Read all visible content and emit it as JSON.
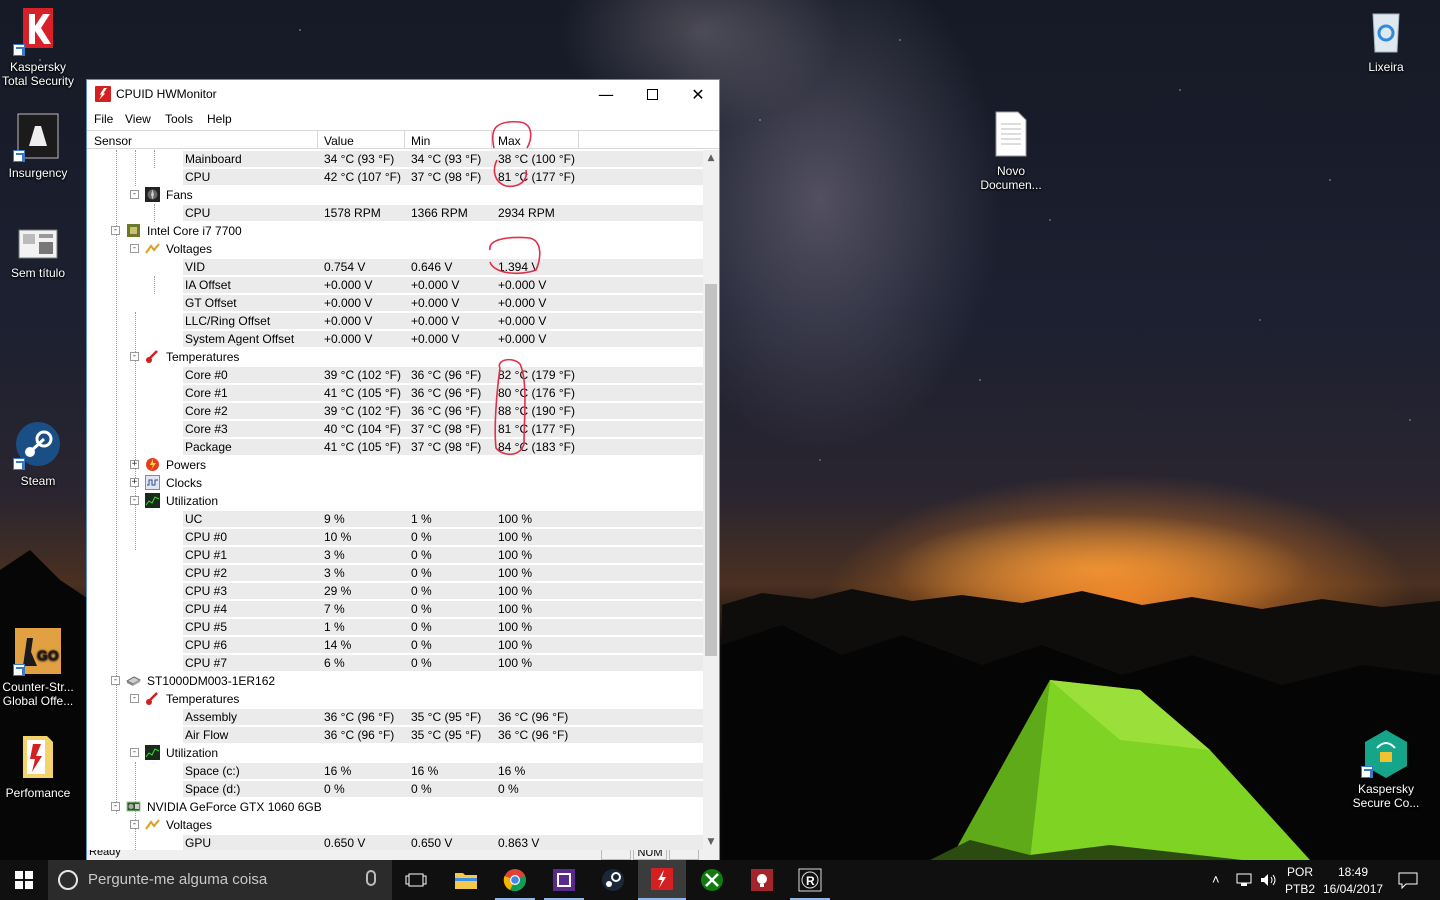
{
  "desktop": {
    "icons_left": [
      {
        "label": "Kaspersky Total Security"
      },
      {
        "label": "Insurgency"
      },
      {
        "label": "Sem título"
      },
      {
        "label": "Steam"
      },
      {
        "label": "Counter-Str... Global Offe..."
      },
      {
        "label": "Perfomance"
      }
    ],
    "icons_right": [
      {
        "label": "Lixeira"
      },
      {
        "label": "Novo Documen..."
      },
      {
        "label": "Kaspersky Secure Co..."
      }
    ]
  },
  "window": {
    "title": "CPUID HWMonitor",
    "menu": [
      "File",
      "View",
      "Tools",
      "Help"
    ],
    "columns": [
      "Sensor",
      "Value",
      "Min",
      "Max"
    ],
    "rows": [
      {
        "label": "Mainboard",
        "value": "34 °C  (93 °F)",
        "min": "34 °C  (93 °F)",
        "max": "38 °C  (100 °F)"
      },
      {
        "label": "CPU",
        "value": "42 °C  (107 °F)",
        "min": "37 °C  (98 °F)",
        "max": "81 °C  (177 °F)"
      },
      {
        "label": "Fans"
      },
      {
        "label": "CPU",
        "value": "1578 RPM",
        "min": "1366 RPM",
        "max": "2934 RPM"
      },
      {
        "label": "Intel Core i7 7700"
      },
      {
        "label": "Voltages"
      },
      {
        "label": "VID",
        "value": "0.754 V",
        "min": "0.646 V",
        "max": "1.394 V"
      },
      {
        "label": "IA Offset",
        "value": "+0.000 V",
        "min": "+0.000 V",
        "max": "+0.000 V"
      },
      {
        "label": "GT Offset",
        "value": "+0.000 V",
        "min": "+0.000 V",
        "max": "+0.000 V"
      },
      {
        "label": "LLC/Ring Offset",
        "value": "+0.000 V",
        "min": "+0.000 V",
        "max": "+0.000 V"
      },
      {
        "label": "System Agent Offset",
        "value": "+0.000 V",
        "min": "+0.000 V",
        "max": "+0.000 V"
      },
      {
        "label": "Temperatures"
      },
      {
        "label": "Core #0",
        "value": "39 °C  (102 °F)",
        "min": "36 °C  (96 °F)",
        "max": "82 °C  (179 °F)"
      },
      {
        "label": "Core #1",
        "value": "41 °C  (105 °F)",
        "min": "36 °C  (96 °F)",
        "max": "80 °C  (176 °F)"
      },
      {
        "label": "Core #2",
        "value": "39 °C  (102 °F)",
        "min": "36 °C  (96 °F)",
        "max": "88 °C  (190 °F)"
      },
      {
        "label": "Core #3",
        "value": "40 °C  (104 °F)",
        "min": "37 °C  (98 °F)",
        "max": "81 °C  (177 °F)"
      },
      {
        "label": "Package",
        "value": "41 °C  (105 °F)",
        "min": "37 °C  (98 °F)",
        "max": "84 °C  (183 °F)"
      },
      {
        "label": "Powers"
      },
      {
        "label": "Clocks"
      },
      {
        "label": "Utilization"
      },
      {
        "label": "UC",
        "value": "9 %",
        "min": "1 %",
        "max": "100 %"
      },
      {
        "label": "CPU #0",
        "value": "10 %",
        "min": "0 %",
        "max": "100 %"
      },
      {
        "label": "CPU #1",
        "value": "3 %",
        "min": "0 %",
        "max": "100 %"
      },
      {
        "label": "CPU #2",
        "value": "3 %",
        "min": "0 %",
        "max": "100 %"
      },
      {
        "label": "CPU #3",
        "value": "29 %",
        "min": "0 %",
        "max": "100 %"
      },
      {
        "label": "CPU #4",
        "value": "7 %",
        "min": "0 %",
        "max": "100 %"
      },
      {
        "label": "CPU #5",
        "value": "1 %",
        "min": "0 %",
        "max": "100 %"
      },
      {
        "label": "CPU #6",
        "value": "14 %",
        "min": "0 %",
        "max": "100 %"
      },
      {
        "label": "CPU #7",
        "value": "6 %",
        "min": "0 %",
        "max": "100 %"
      },
      {
        "label": "ST1000DM003-1ER162"
      },
      {
        "label": "Temperatures"
      },
      {
        "label": "Assembly",
        "value": "36 °C  (96 °F)",
        "min": "35 °C  (95 °F)",
        "max": "36 °C  (96 °F)"
      },
      {
        "label": "Air Flow",
        "value": "36 °C  (96 °F)",
        "min": "35 °C  (95 °F)",
        "max": "36 °C  (96 °F)"
      },
      {
        "label": "Utilization"
      },
      {
        "label": "Space (c:)",
        "value": "16 %",
        "min": "16 %",
        "max": "16 %"
      },
      {
        "label": "Space (d:)",
        "value": "0 %",
        "min": "0 %",
        "max": "0 %"
      },
      {
        "label": "NVIDIA GeForce GTX 1060 6GB"
      },
      {
        "label": "Voltages"
      },
      {
        "label": "GPU",
        "value": "0.650 V",
        "min": "0.650 V",
        "max": "0.863 V"
      }
    ],
    "status": {
      "left": "Ready",
      "num": "NUM"
    }
  },
  "taskbar": {
    "search_placeholder": "Pergunte-me alguma coisa",
    "apps": [
      "task-view",
      "file-explorer",
      "chrome",
      "cpu-app",
      "steam",
      "hwmonitor",
      "xbox",
      "app-bulb",
      "app-r"
    ],
    "lang_top": "POR",
    "lang_bottom": "PTB2",
    "time": "18:49",
    "date": "16/04/2017"
  }
}
